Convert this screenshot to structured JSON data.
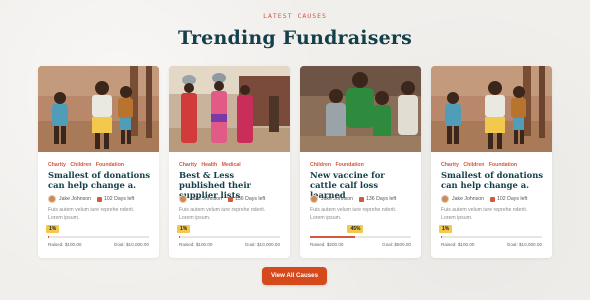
{
  "header": {
    "eyebrow": "Latest Causes",
    "title": "Trending Fundraisers"
  },
  "cards": [
    {
      "categories": [
        "Charity",
        "Children",
        "Foundation"
      ],
      "title": "Smallest of donations can help change a.",
      "author": "Jake Johnson",
      "days_left": "102 Days left",
      "description": "Fuis autem velum iure reprehe nderit. Lorem ipsum.",
      "progress_label": "1%",
      "progress": 0.01,
      "raised": "Raised: $100.00",
      "goal": "Goal: $10,000.00",
      "photo": "children-photo"
    },
    {
      "categories": [
        "Charity",
        "Health",
        "Medical"
      ],
      "title": "Best & Less published their supplier lists",
      "author": "Jake Johnson",
      "days_left": "136 Days left",
      "description": "Fuis autem velum iure reprehe nderit. Lorem ipsum.",
      "progress_label": "1%",
      "progress": 0.01,
      "raised": "Raised: $100.00",
      "goal": "Goal: $10,000.00",
      "photo": "women-water-photo"
    },
    {
      "categories": [
        "Children",
        "Foundation"
      ],
      "title": "New vaccine for cattle calf loss learned",
      "author": "Jake Johnson",
      "days_left": "136 Days left",
      "description": "Fuis autem velum iure reprehe nderit. Lorem ipsum.",
      "progress_label": "45%",
      "progress": 0.45,
      "raised": "Raised: $200.00",
      "goal": "Goal: $500.00",
      "photo": "mother-children-photo"
    },
    {
      "categories": [
        "Charity",
        "Children",
        "Foundation"
      ],
      "title": "Smallest of donations can help change a.",
      "author": "Jake Johnson",
      "days_left": "102 Days left",
      "description": "Fuis autem velum iure reprehe nderit. Lorem ipsum.",
      "progress_label": "1%",
      "progress": 0.01,
      "raised": "Raised: $100.00",
      "goal": "Goal: $10,000.00",
      "photo": "children-photo"
    }
  ],
  "cta": {
    "label": "View All Causes"
  },
  "colors": {
    "accent": "#d2583f",
    "heading": "#13404a",
    "button": "#d44a1c",
    "badge": "#f2c94c"
  }
}
